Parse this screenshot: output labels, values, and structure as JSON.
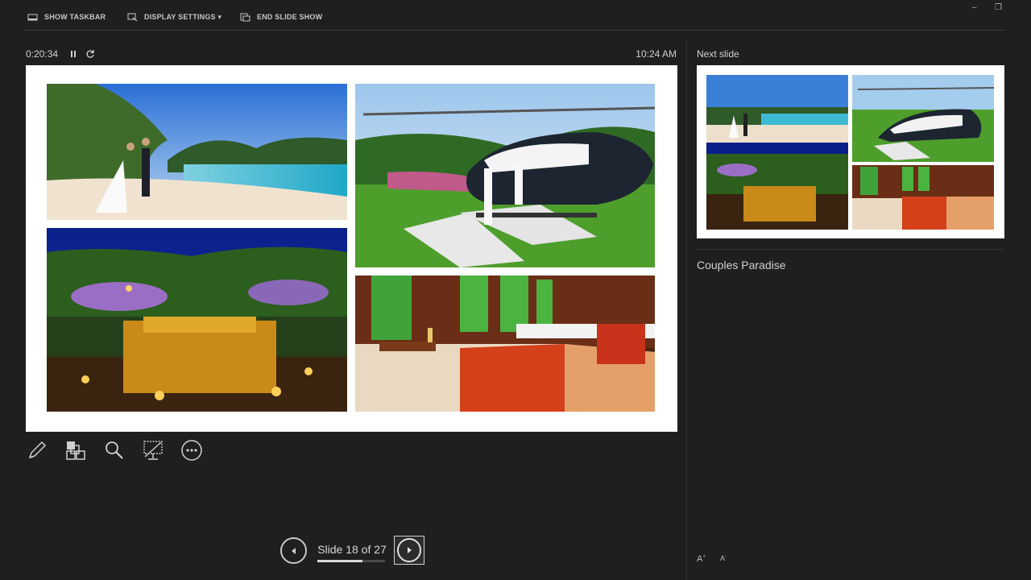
{
  "toolbar": {
    "show_taskbar": "SHOW TASKBAR",
    "display_settings": "DISPLAY SETTINGS ▾",
    "end_slide_show": "END SLIDE SHOW"
  },
  "presenter": {
    "elapsed_time": "0:20:34",
    "clock": "10:24 AM",
    "slide_counter": "Slide 18 of 27",
    "progress_fraction": 0.667
  },
  "next_slide": {
    "label": "Next slide"
  },
  "notes": {
    "text": "Couples Paradise"
  },
  "icons": {
    "pen": "pen-icon",
    "see_all_slides": "see-all-slides-icon",
    "zoom": "magnifier-icon",
    "black_screen": "screen-icon",
    "more": "ellipsis-icon",
    "prev": "prev-arrow-icon",
    "next": "next-arrow-icon"
  },
  "colors": {
    "background": "#1f1f1f",
    "slide_bg": "#ffffff",
    "text": "#d8d8d8"
  }
}
